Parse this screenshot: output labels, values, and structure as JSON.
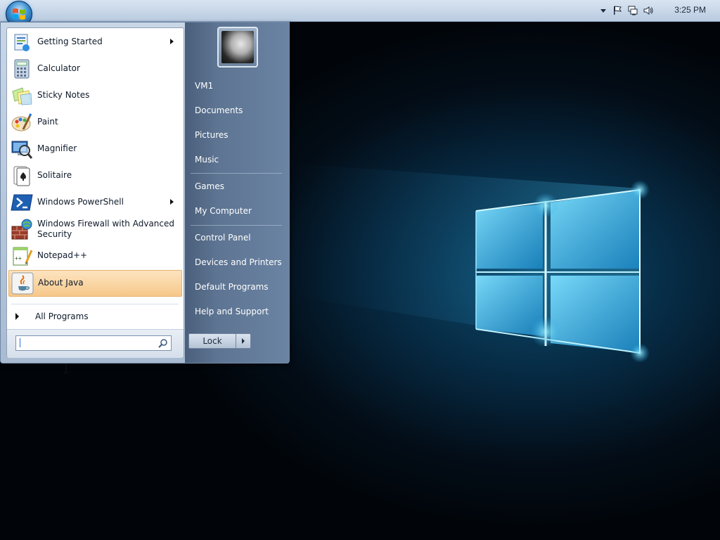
{
  "taskbar": {
    "clock": "3:25 PM",
    "tray_icons": [
      "chevron-down-icon",
      "flag-icon",
      "network-icon",
      "volume-icon"
    ]
  },
  "start_menu": {
    "programs": [
      {
        "label": "Getting Started",
        "icon": "getting-started-icon",
        "has_submenu": true
      },
      {
        "label": "Calculator",
        "icon": "calculator-icon",
        "has_submenu": false
      },
      {
        "label": "Sticky Notes",
        "icon": "sticky-notes-icon",
        "has_submenu": false
      },
      {
        "label": "Paint",
        "icon": "paint-icon",
        "has_submenu": false
      },
      {
        "label": "Magnifier",
        "icon": "magnifier-icon",
        "has_submenu": false
      },
      {
        "label": "Solitaire",
        "icon": "solitaire-icon",
        "has_submenu": false
      },
      {
        "label": "Windows PowerShell",
        "icon": "powershell-icon",
        "has_submenu": true
      },
      {
        "label": "Windows Firewall with Advanced Security",
        "icon": "firewall-icon",
        "has_submenu": false
      },
      {
        "label": "Notepad++",
        "icon": "notepad-plus-plus-icon",
        "has_submenu": false
      },
      {
        "label": "About Java",
        "icon": "java-icon",
        "has_submenu": false,
        "selected": true
      }
    ],
    "all_programs": "All Programs",
    "search": {
      "value": ""
    },
    "right_links": [
      {
        "label": "VM1"
      },
      {
        "label": "Documents"
      },
      {
        "label": "Pictures"
      },
      {
        "label": "Music"
      },
      {
        "label": "Games"
      },
      {
        "label": "My Computer"
      },
      {
        "label": "Control Panel"
      },
      {
        "label": "Devices and Printers"
      },
      {
        "label": "Default Programs"
      },
      {
        "label": "Help and Support"
      }
    ],
    "lock_label": "Lock"
  },
  "colors": {
    "selected_item": "#f6c88a",
    "right_pane": "#5d7492",
    "wallpaper_glow": "#22b3e6"
  }
}
